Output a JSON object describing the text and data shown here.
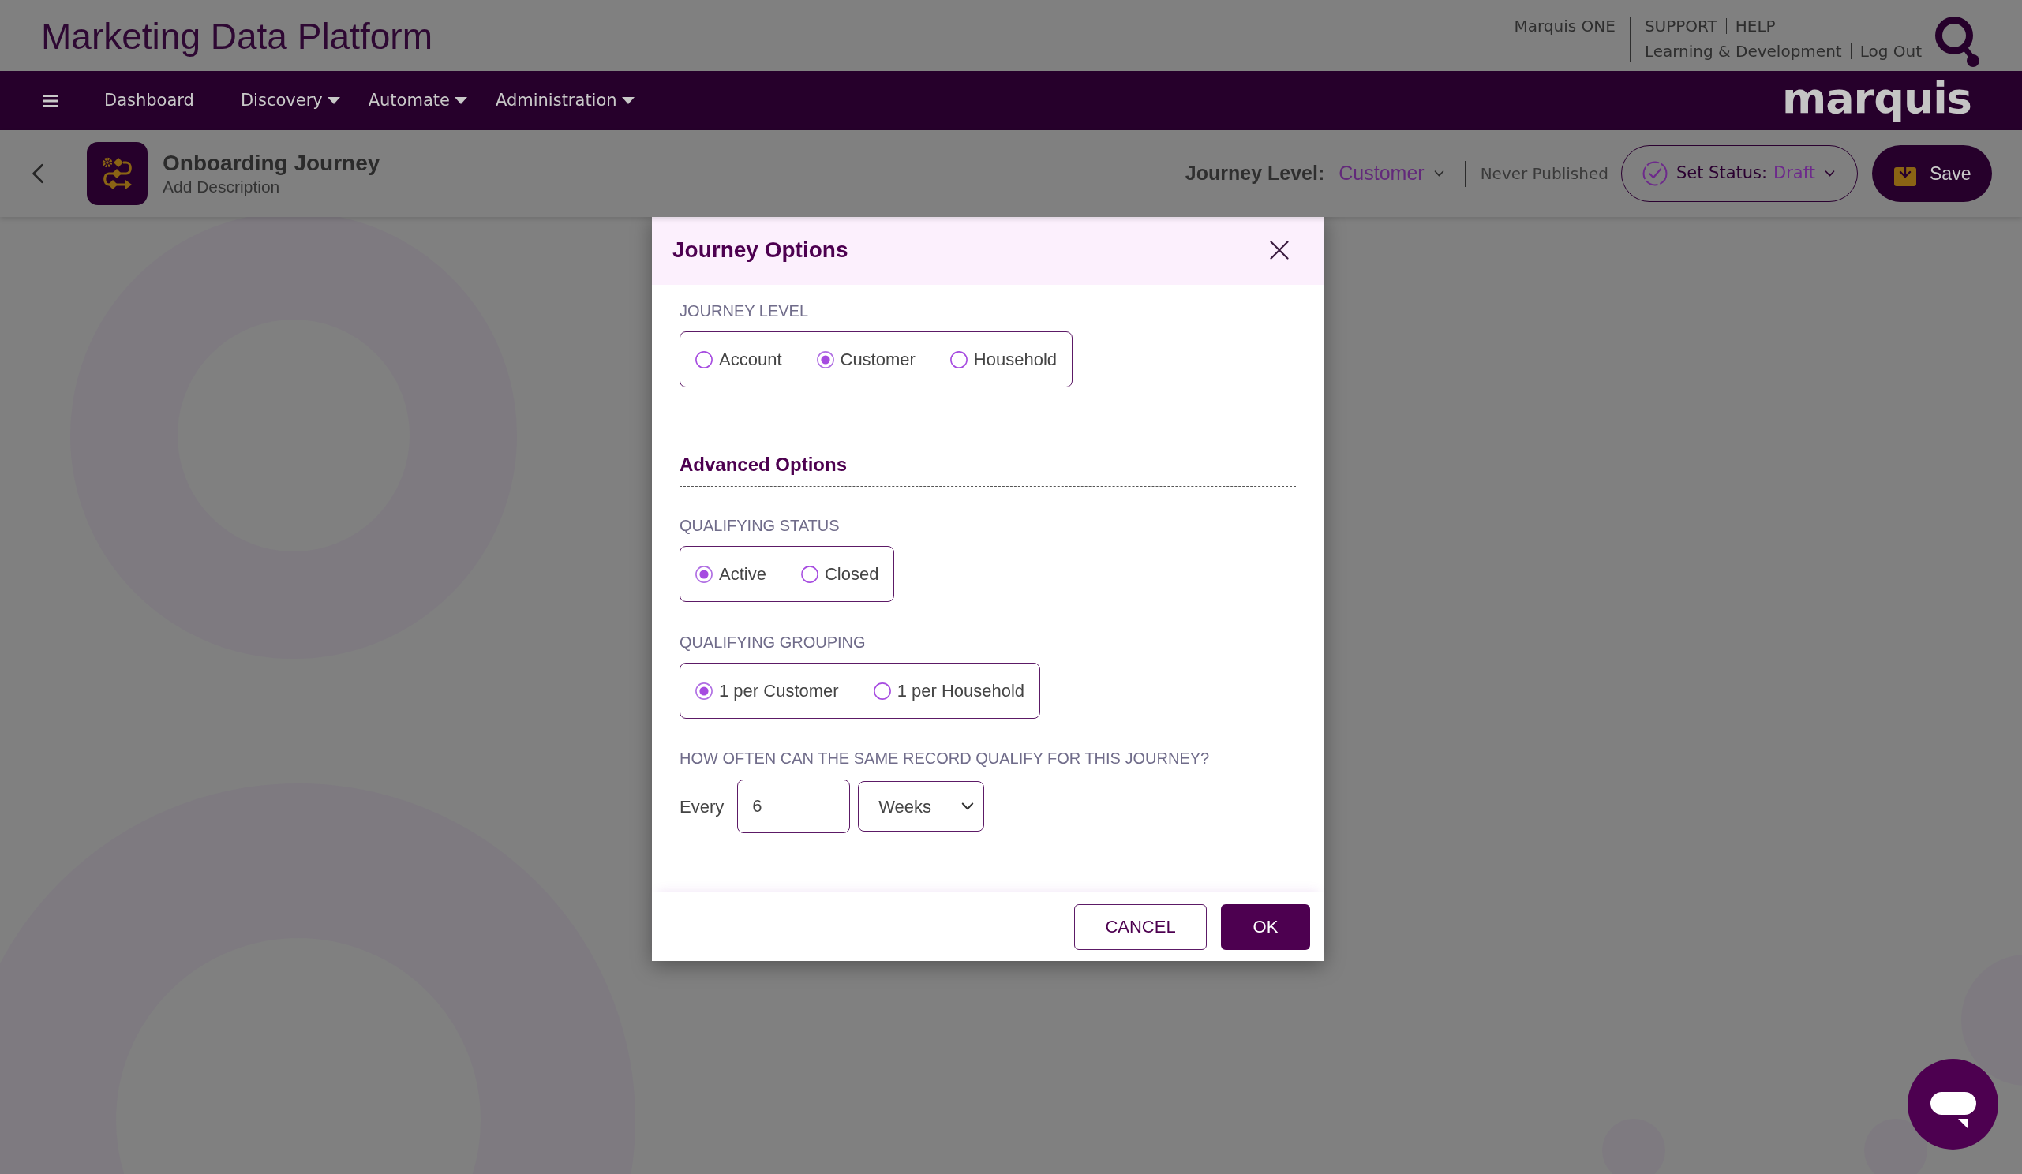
{
  "header": {
    "title": "Marketing Data Platform",
    "product_link": "Marquis ONE",
    "link_rows": [
      {
        "links": [
          "SUPPORT",
          "HELP"
        ]
      },
      {
        "links": [
          "Learning & Development",
          "Log Out"
        ]
      }
    ]
  },
  "nav": {
    "items": [
      {
        "label": "Dashboard",
        "dropdown": false
      },
      {
        "label": "Discovery",
        "dropdown": true
      },
      {
        "label": "Automate",
        "dropdown": true
      },
      {
        "label": "Administration",
        "dropdown": true
      }
    ],
    "brand": "marquis"
  },
  "journey_header": {
    "title": "Onboarding Journey",
    "description": "Add Description",
    "level_label": "Journey Level:",
    "level_value": "Customer",
    "publish_state": "Never Published",
    "status_label": "Set Status:",
    "status_value": "Draft",
    "save_label": "Save"
  },
  "dialog": {
    "title": "Journey Options",
    "level_group": {
      "label": "JOURNEY LEVEL",
      "options": [
        {
          "label": "Account",
          "selected": false
        },
        {
          "label": "Customer",
          "selected": true
        },
        {
          "label": "Household",
          "selected": false
        }
      ]
    },
    "advanced_heading": "Advanced Options",
    "advanced_groups": [
      {
        "label": "QUALIFYING STATUS",
        "options": [
          {
            "label": "Active",
            "selected": true
          },
          {
            "label": "Closed",
            "selected": false
          }
        ]
      },
      {
        "label": "QUALIFYING GROUPING",
        "options": [
          {
            "label": "1 per Customer",
            "selected": true
          },
          {
            "label": "1 per Household",
            "selected": false
          }
        ]
      }
    ],
    "frequency": {
      "label": "HOW OFTEN CAN THE SAME RECORD QUALIFY FOR THIS JOURNEY?",
      "prefix": "Every",
      "value": "6",
      "unit": "Weeks"
    },
    "buttons": [
      {
        "label": "CANCEL",
        "kind": "secondary"
      },
      {
        "label": "OK",
        "kind": "primary"
      }
    ]
  }
}
